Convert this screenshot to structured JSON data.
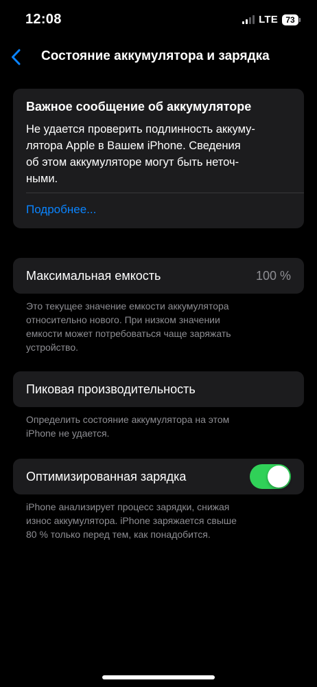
{
  "status_bar": {
    "time": "12:08",
    "network": "LTE",
    "battery_level": "73"
  },
  "nav": {
    "back_icon": "chevron-left-icon",
    "title": "Состояние аккумулятора и зарядка"
  },
  "alert": {
    "title": "Важное сообщение об аккумуляторе",
    "lines": [
      "Не удается проверить подлинность аккуму-",
      "лятора Apple в Вашем iPhone. Сведения",
      "об этом аккумуляторе могут быть неточ-",
      "ными."
    ],
    "link": "Подробнее..."
  },
  "capacity": {
    "label": "Максимальная емкость",
    "value": "100 %",
    "footnote_lines": [
      "Это текущее значение емкости аккумулятора",
      "относительно нового. При низком значении",
      "емкости может потребоваться чаще заряжать",
      "устройство."
    ]
  },
  "peak": {
    "label": "Пиковая производительность",
    "footnote_lines": [
      "Определить состояние аккумулятора на этом",
      "iPhone не удается."
    ]
  },
  "optimized": {
    "label": "Оптимизированная зарядка",
    "enabled": true,
    "footnote_lines": [
      "iPhone анализирует процесс зарядки, снижая",
      "износ аккумулятора. iPhone заряжается свыше",
      "80 % только перед тем, как понадобится."
    ]
  },
  "colors": {
    "accent": "#0a84ff",
    "toggle_on": "#30d158",
    "card_bg": "#1c1c1e",
    "secondary_text": "#8e8e93"
  }
}
